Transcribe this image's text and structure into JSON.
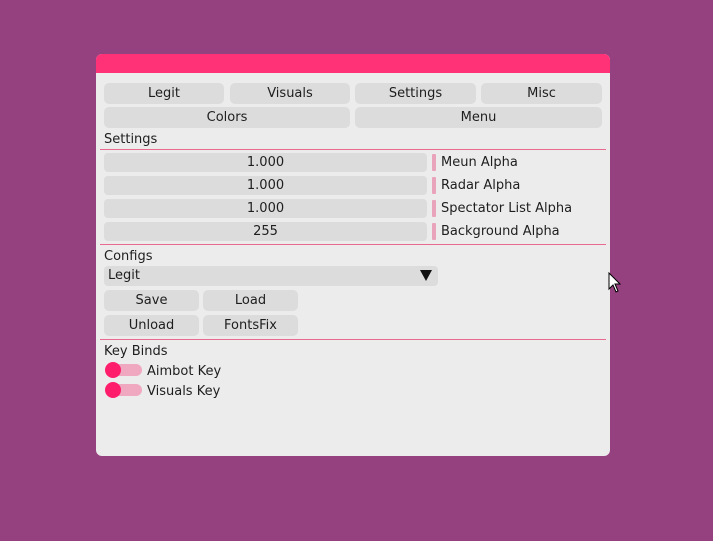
{
  "colors": {
    "background": "#96417f",
    "accent": "#ff3278",
    "panel": "#ececec",
    "control": "#dcdcdc",
    "separator": "#e86a8e",
    "toggle_knob": "#ff1d6c"
  },
  "tabs": {
    "row1": [
      "Legit",
      "Visuals",
      "Settings",
      "Misc"
    ],
    "row2": [
      "Colors",
      "Menu"
    ]
  },
  "settings": {
    "heading": "Settings",
    "sliders": [
      {
        "value": "1.000",
        "label": "Meun Alpha"
      },
      {
        "value": "1.000",
        "label": "Radar Alpha"
      },
      {
        "value": "1.000",
        "label": "Spectator List Alpha"
      },
      {
        "value": "255",
        "label": "Background Alpha"
      }
    ]
  },
  "configs": {
    "heading": "Configs",
    "selected": "Legit",
    "buttons": [
      "Save",
      "Load",
      "Unload",
      "FontsFix"
    ]
  },
  "keybinds": {
    "heading": "Key Binds",
    "toggles": [
      {
        "label": "Aimbot Key",
        "on": false
      },
      {
        "label": "Visuals Key",
        "on": false
      }
    ]
  },
  "icons": {
    "dropdown": "triangle-down-icon",
    "cursor": "mouse-pointer-icon"
  }
}
